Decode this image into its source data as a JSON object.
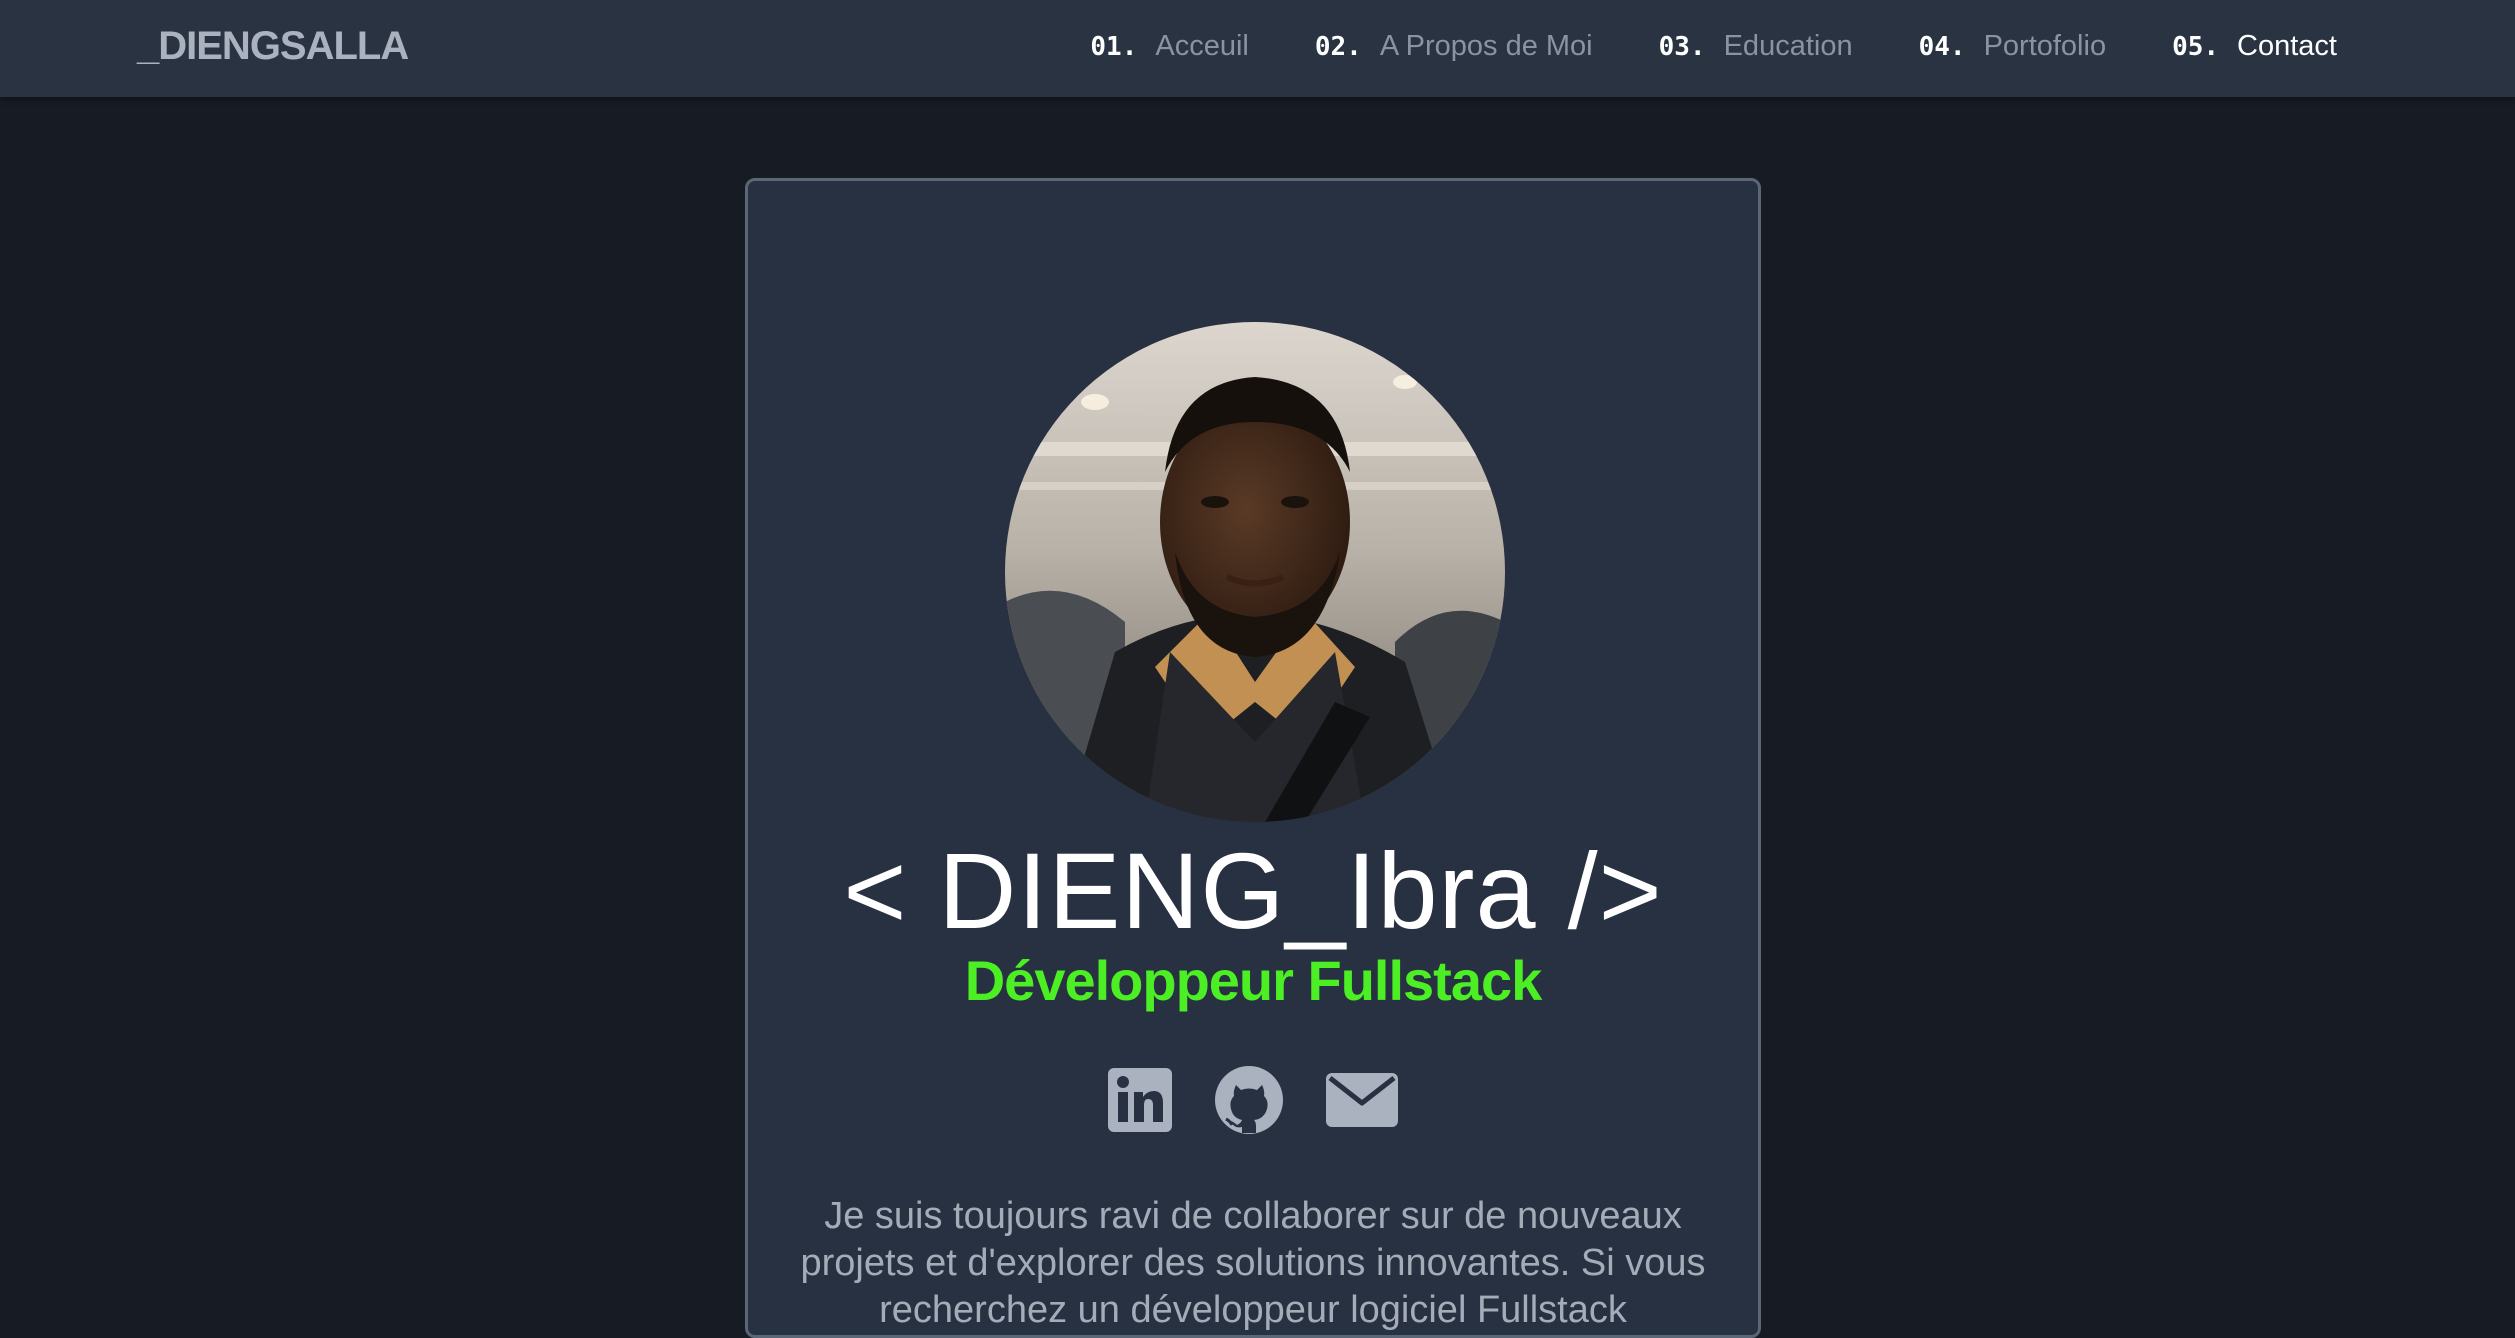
{
  "nav": {
    "brand": "_DIENGSALLA",
    "items": [
      {
        "num": "01.",
        "label": "Acceuil"
      },
      {
        "num": "02.",
        "label": "A Propos de Moi"
      },
      {
        "num": "03.",
        "label": "Education"
      },
      {
        "num": "04.",
        "label": "Portofolio"
      },
      {
        "num": "05.",
        "label": "Contact"
      }
    ],
    "active_item": "Contact"
  },
  "profile": {
    "name": "< DIENG_Ibra />",
    "role": "Développeur Fullstack",
    "socials": [
      "linkedin-icon",
      "github-icon",
      "envelope-icon"
    ],
    "intro": "Je suis toujours ravi de collaborer sur de nouveaux projets et d'explorer des solutions innovantes. Si vous recherchez un développeur logiciel Fullstack"
  },
  "colors": {
    "page_background": "#161b24",
    "navbar_background": "#2a3342",
    "card_background": "#283141",
    "card_border": "#5b6677",
    "accent_green": "#4cee24",
    "muted_text": "#8a93a2",
    "icon_gray": "#aab2bf"
  }
}
